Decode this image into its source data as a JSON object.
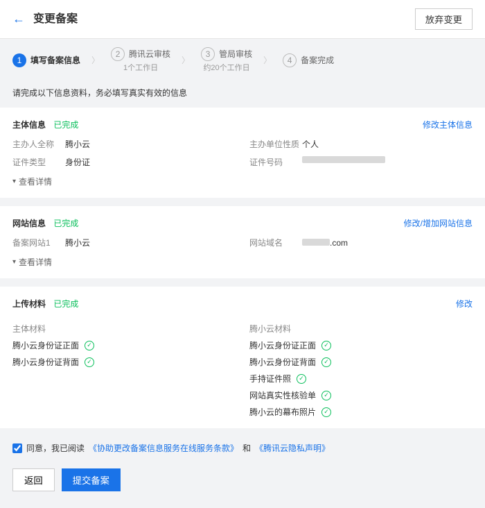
{
  "header": {
    "title": "变更备案",
    "discard": "放弃变更"
  },
  "steps": [
    {
      "num": "1",
      "label": "填写备案信息",
      "sub": ""
    },
    {
      "num": "2",
      "label": "腾讯云审核",
      "sub": "1个工作日"
    },
    {
      "num": "3",
      "label": "管局审核",
      "sub": "约20个工作日"
    },
    {
      "num": "4",
      "label": "备案完成",
      "sub": ""
    }
  ],
  "notice": "请完成以下信息资料，务必填写真实有效的信息",
  "subject": {
    "title": "主体信息",
    "status": "已完成",
    "modify": "修改主体信息",
    "owner_label": "主办人全称",
    "owner": "腾小云",
    "unit_label": "主办单位性质",
    "unit": "个人",
    "idtype_label": "证件类型",
    "idtype": "身份证",
    "idnum_label": "证件号码",
    "expand": "查看详情"
  },
  "site": {
    "title": "网站信息",
    "status": "已完成",
    "modify": "修改/增加网站信息",
    "site_label": "备案网站1",
    "site_name": "腾小云",
    "domain_label": "网站域名",
    "domain": ".com",
    "expand": "查看详情"
  },
  "upload": {
    "title": "上传材料",
    "status": "已完成",
    "modify": "修改",
    "col1_title": "主体材料",
    "col1": [
      "腾小云身份证正面",
      "腾小云身份证背面"
    ],
    "col2_title": "腾小云材料",
    "col2": [
      "腾小云身份证正面",
      "腾小云身份证背面",
      "手持证件照",
      "网站真实性核验单",
      "腾小云的幕布照片"
    ]
  },
  "agree": {
    "text": "同意，我已阅读",
    "link1": "《协助更改备案信息服务在线服务条款》",
    "and": "和",
    "link2": "《腾讯云隐私声明》"
  },
  "footer": {
    "back": "返回",
    "submit": "提交备案"
  }
}
